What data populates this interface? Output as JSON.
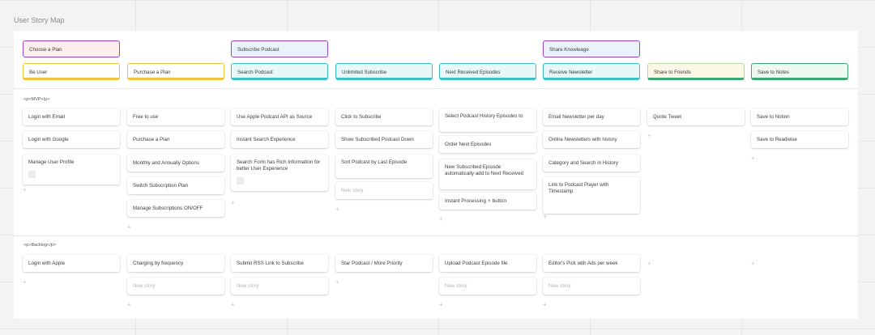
{
  "page": {
    "title": "User Story Map"
  },
  "activities": [
    {
      "label": "Choose a Plan"
    },
    {
      "label": "Subscribe Podcast"
    },
    {
      "label": "Share Knowleage"
    }
  ],
  "steps": [
    {
      "label": "Be User"
    },
    {
      "label": "Purchase a Plan"
    },
    {
      "label": "Search Podcast"
    },
    {
      "label": "Unlimited Subscribe"
    },
    {
      "label": "Next Received Episodes"
    },
    {
      "label": "Receive Newsletter"
    },
    {
      "label": "Share to Friends"
    },
    {
      "label": "Save to Notes"
    }
  ],
  "releases": [
    {
      "label": "<p>MVP</p>",
      "columns": [
        [
          "Login with Email",
          "Login with Google",
          "Manage User Profile"
        ],
        [
          "Free to use",
          "Purchase a Plan",
          "Monthly and Annually Options",
          "Switch Subscription Plan",
          "Manage Subscriptions ON/OFF"
        ],
        [
          "Use Apple Podcast API as Source",
          "Instant Search Experience",
          "Search Form has Rich Information for better User Experience"
        ],
        [
          "Click to Subscribe",
          "Show Subscribed Podcast Down",
          "Sort Podcast by Last Episode",
          "New story"
        ],
        [
          "Select Podcast History Episodes to",
          "Order Next Episodes",
          "New Subscribed Episode automatically add to Next Received",
          "Instant Processing ⚡ button"
        ],
        [
          "Email Newsletter per day",
          "Online Newsletters with history",
          "Category and Search in History",
          "Link to Podcast Player with Timestamp"
        ],
        [
          "Quote Tweet"
        ],
        [
          "Save to Notion",
          "Save to Readwise"
        ]
      ]
    },
    {
      "label": "<p>Backlog</p>",
      "columns": [
        [
          "Login with Apple"
        ],
        [
          "Charging by frequency",
          "New story"
        ],
        [
          "Submit RSS Link to Subscribe",
          "New story"
        ],
        [
          "Star Podcast / More Priority"
        ],
        [
          "Upload Podcast Episode file",
          "New story"
        ],
        [
          "Editor's Pick with Ads per week",
          "New story"
        ],
        [],
        []
      ]
    }
  ],
  "add_symbol": "+",
  "colors": {
    "activity": "#9646c9",
    "step_yellow": "#f0c33a",
    "step_teal": "#39c2c8",
    "step_green": "#3aa872"
  }
}
